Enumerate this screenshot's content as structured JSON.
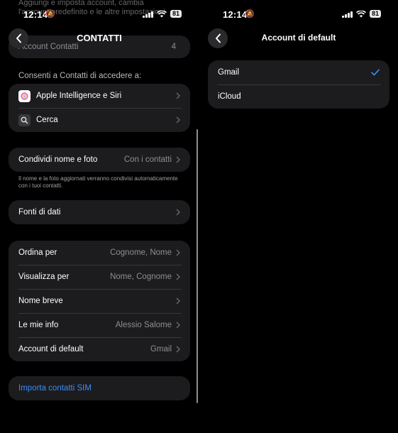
{
  "status": {
    "time": "12:14",
    "battery": "81"
  },
  "left": {
    "title": "CONTATTI",
    "ghost_text": "Aggiungi e imposta account, cambia l'account predefinito e le altre impostazioni",
    "account_row": {
      "label": "Account Contatti",
      "value": "4"
    },
    "access_header": "Consenti a Contatti di accedere a:",
    "access_items": [
      {
        "label": "Apple Intelligence e Siri",
        "icon": "apple-intelligence-icon"
      },
      {
        "label": "Cerca",
        "icon": "search-icon"
      }
    ],
    "share": {
      "label": "Condividi nome e foto",
      "value": "Con i contatti"
    },
    "share_note": "Il nome e la foto aggiornati verranno condivisi automaticamente con i tuoi contatti.",
    "sources": {
      "label": "Fonti di dati"
    },
    "settings": [
      {
        "label": "Ordina per",
        "value": "Cognome, Nome"
      },
      {
        "label": "Visualizza per",
        "value": "Nome, Cognome"
      },
      {
        "label": "Nome breve",
        "value": ""
      },
      {
        "label": "Le mie info",
        "value": "Alessio Salome"
      },
      {
        "label": "Account di default",
        "value": "Gmail"
      }
    ],
    "import_sim": "Importa contatti SIM"
  },
  "right": {
    "title": "Account di default",
    "options": [
      {
        "label": "Gmail",
        "selected": true
      },
      {
        "label": "iCloud",
        "selected": false
      }
    ]
  },
  "colors": {
    "accent": "#3b8cf6",
    "card": "#1c1c1e",
    "background": "#000000"
  }
}
